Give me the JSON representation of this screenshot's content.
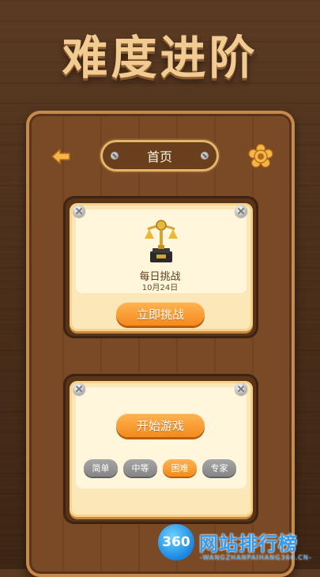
{
  "headline": "难度进阶",
  "header": {
    "title": "首页",
    "back_icon": "back-arrow-icon",
    "settings_icon": "gear-flower-icon"
  },
  "daily_challenge": {
    "title": "每日挑战",
    "date": "10月24日",
    "button_label": "立即挑战",
    "icon": "trophy-icon"
  },
  "play": {
    "button_label": "开始游戏",
    "difficulties": [
      {
        "label": "简单",
        "selected": false
      },
      {
        "label": "中等",
        "selected": false
      },
      {
        "label": "困难",
        "selected": true
      },
      {
        "label": "专家",
        "selected": false
      }
    ]
  },
  "watermark": {
    "logo_text": "360",
    "text": "网站排行榜",
    "sub": "-WANGZHANPAIHANG360.CN-"
  },
  "colors": {
    "accent_orange": "#f38a1e",
    "wood_dark": "#5a3418",
    "card_cream": "#fbe7b8",
    "headline": "#f1cb92"
  }
}
